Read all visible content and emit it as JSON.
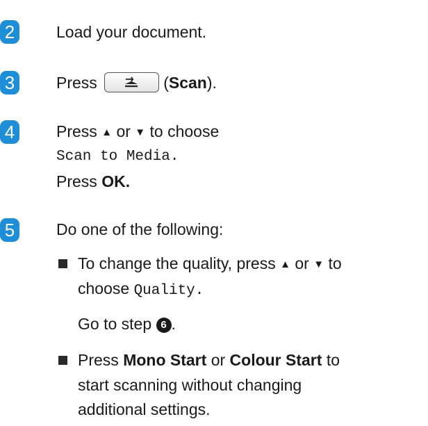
{
  "steps": [
    {
      "num": "2",
      "text": "Load your document."
    },
    {
      "num": "3",
      "press": "Press",
      "scan_label": "Scan"
    },
    {
      "num": "4",
      "line1_a": "Press",
      "line1_b": "or",
      "line1_c": "to choose",
      "menu_option": "Scan to Media.",
      "line3_a": "Press",
      "line3_b": "OK."
    },
    {
      "num": "5",
      "text": "Do one of the following:"
    }
  ],
  "bullets": [
    {
      "line1": "To change the quality, press",
      "line1_or": "or",
      "line1_to": "to",
      "line2_a": "choose",
      "line2_mono": "Quality.",
      "goto_a": "Go to step",
      "goto_ref": "6",
      "goto_end": "."
    },
    {
      "press": "Press",
      "mono_start": "Mono Start",
      "or": "or",
      "colour_start": "Colour Start",
      "to": "to",
      "line2": "start scanning without changing",
      "line3": "additional settings."
    }
  ],
  "glyphs": {
    "up": "▲",
    "down": "▼"
  }
}
